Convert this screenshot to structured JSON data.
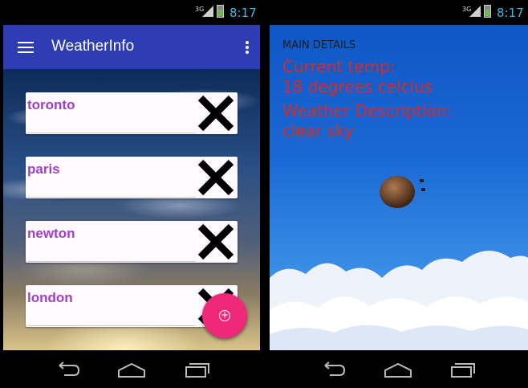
{
  "left_screen": {
    "status_bar": {
      "network": "3G",
      "time": "8:17"
    },
    "app_bar": {
      "title": "WeatherInfo",
      "menu_icon": "hamburger-menu-icon",
      "overflow_icon": "more-vert-icon"
    },
    "cities": [
      {
        "name": "toronto"
      },
      {
        "name": "paris"
      },
      {
        "name": "newton"
      },
      {
        "name": "london"
      }
    ],
    "fab_icon": "add-circle-icon",
    "colors": {
      "app_bar": "#2e3db4",
      "city_text": "#a03ec6",
      "fab": "#f0287a"
    }
  },
  "right_screen": {
    "status_bar": {
      "network": "3G",
      "time": "8:17"
    },
    "main_details_label": "MAIN DETAILS",
    "current_temp_label": "Current temp:",
    "current_temp_value": "18 degrees celcius",
    "weather_description_label": "Weather Description:",
    "weather_description_value": "clear sky",
    "weather_icon": "clear-sky-weather-icon",
    "colors": {
      "background": "#1a68d4",
      "detail_text": "#d62b27"
    }
  },
  "nav_bar": {
    "back_icon": "back-icon",
    "home_icon": "home-icon",
    "recents_icon": "recent-apps-icon"
  }
}
